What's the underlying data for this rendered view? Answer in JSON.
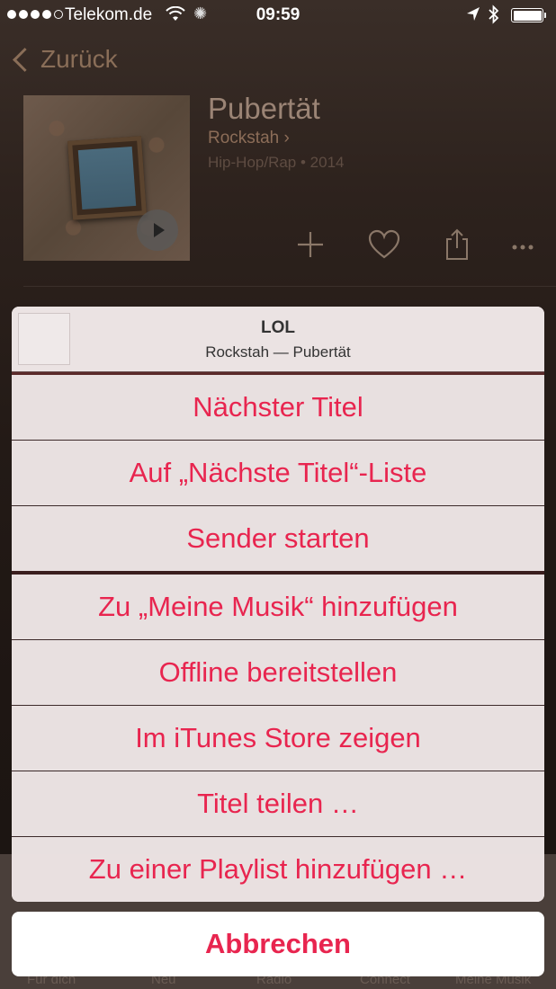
{
  "status_bar": {
    "carrier": "Telekom.de",
    "time": "09:59",
    "signal_icon": "signal-dots-icon",
    "wifi_icon": "wifi-icon",
    "activity_icon": "activity-spinner-icon",
    "location_icon": "location-arrow-icon",
    "bluetooth_icon": "bluetooth-icon",
    "battery_icon": "battery-icon"
  },
  "nav": {
    "back_label": "Zurück",
    "back_icon": "chevron-left-icon"
  },
  "album": {
    "title": "Pubertät",
    "artist": "Rockstah",
    "genre_year": "Hip-Hop/Rap • 2014",
    "actions": [
      "plus-icon",
      "heart-icon",
      "share-icon",
      "more-icon"
    ]
  },
  "tab_bar": {
    "mini_player": "Rockstah — Pubertät",
    "tabs": [
      "Für dich",
      "Neu",
      "Radio",
      "Connect",
      "Meine Musik"
    ]
  },
  "action_sheet": {
    "song_title": "LOL",
    "song_subtitle": "Rockstah — Pubertät",
    "group1": [
      "Nächster Titel",
      "Auf „Nächste Titel“-Liste",
      "Sender starten"
    ],
    "group2": [
      "Zu „Meine Musik“ hinzufügen",
      "Offline bereitstellen",
      "Im iTunes Store zeigen",
      "Titel teilen …",
      "Zu einer Playlist hinzufügen …"
    ],
    "cancel_label": "Abbrechen"
  },
  "colors": {
    "accent": "#e8254f",
    "sheet_bg": "#ebe3e3",
    "background": "#2a1f1b"
  }
}
